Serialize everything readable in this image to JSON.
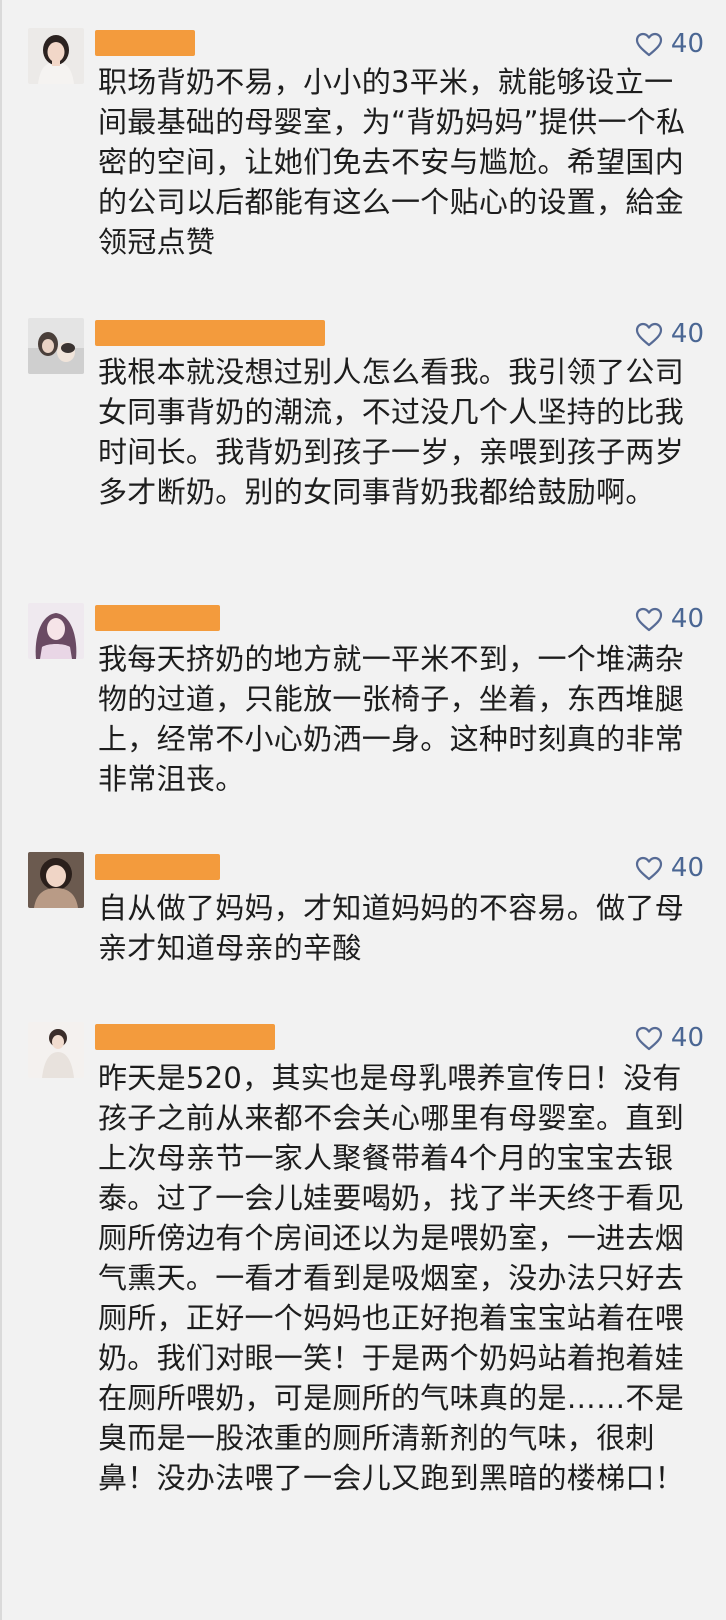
{
  "comments": [
    {
      "likes": "40",
      "text": "职场背奶不易，小小的3平米，就能够设立一间最基础的母婴室，为“背奶妈妈”提供一个私密的空间，让她们免去不安与尴尬。希望国内的公司以后都能有这么一个贴心的设置，給金领冠点赞"
    },
    {
      "likes": "40",
      "text": "我根本就没想过别人怎么看我。我引领了公司女同事背奶的潮流，不过没几个人坚持的比我时间长。我背奶到孩子一岁，亲喂到孩子两岁多才断奶。别的女同事背奶我都给鼓励啊。"
    },
    {
      "likes": "40",
      "text": "我每天挤奶的地方就一平米不到，一个堆满杂物的过道，只能放一张椅子，坐着，东西堆腿上，经常不小心奶洒一身。这种时刻真的非常非常沮丧。"
    },
    {
      "likes": "40",
      "text": "自从做了妈妈，才知道妈妈的不容易。做了母亲才知道母亲的辛酸"
    },
    {
      "likes": "40",
      "text": "昨天是520，其实也是母乳喂养宣传日！没有孩子之前从来都不会关心哪里有母婴室。直到上次母亲节一家人聚餐带着4个月的宝宝去银泰。过了一会儿娃要喝奶，找了半天终于看见厕所傍边有个房间还以为是喂奶室，一进去烟气熏天。一看才看到是吸烟室，没办法只好去厕所，正好一个妈妈也正好抱着宝宝站着在喂奶。我们对眼一笑！于是两个奶妈站着抱着娃在厕所喂奶，可是厕所的气味真的是……不是臭而是一股浓重的厕所清新剂的气味，很刺鼻！没办法喂了一会儿又跑到黑暗的楼梯口！"
    }
  ],
  "colors": {
    "name_redaction": "#f39b3d",
    "like_color": "#576b95",
    "background": "#f2f2f2"
  },
  "icons": {
    "like": "heart-outline-icon"
  }
}
